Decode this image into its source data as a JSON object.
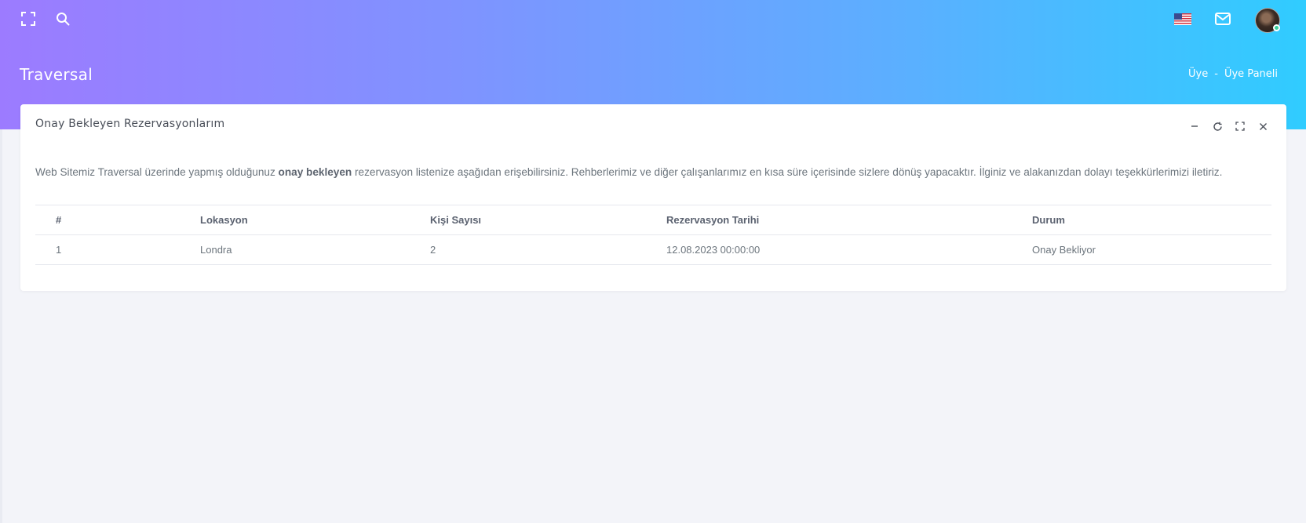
{
  "header": {
    "icons": [
      "fullscreen-icon",
      "search-icon",
      "us-flag-icon",
      "mail-icon",
      "user-avatar"
    ],
    "user_status_color": "#3ad29f"
  },
  "page": {
    "title": "Traversal",
    "breadcrumb": [
      "Üye",
      "-",
      "Üye Paneli"
    ]
  },
  "card": {
    "title": "Onay Bekleyen Rezervasyonlarım",
    "tools": [
      "minimize-icon",
      "refresh-icon",
      "expand-icon",
      "close-icon"
    ],
    "description_before": "Web Sitemiz Traversal üzerinde yapmış olduğunuz ",
    "description_bold": "onay bekleyen",
    "description_after": " rezervasyon listenize aşağıdan erişebilirsiniz. Rehberlerimiz ve diğer çalışanlarımız en kısa süre içerisinde sizlere dönüş yapacaktır. İlginiz ve alakanızdan dolayı teşekkürlerimizi iletiriz."
  },
  "table": {
    "headers": [
      "#",
      "Lokasyon",
      "Kişi Sayısı",
      "Rezervasyon Tarihi",
      "Durum"
    ],
    "rows": [
      [
        "1",
        "Londra",
        "2",
        "12.08.2023 00:00:00",
        "Onay Bekliyor"
      ]
    ]
  },
  "colors": {
    "gradient_start": "#9c7bff",
    "gradient_end": "#30ccff",
    "page_background": "#f3f4f9"
  }
}
